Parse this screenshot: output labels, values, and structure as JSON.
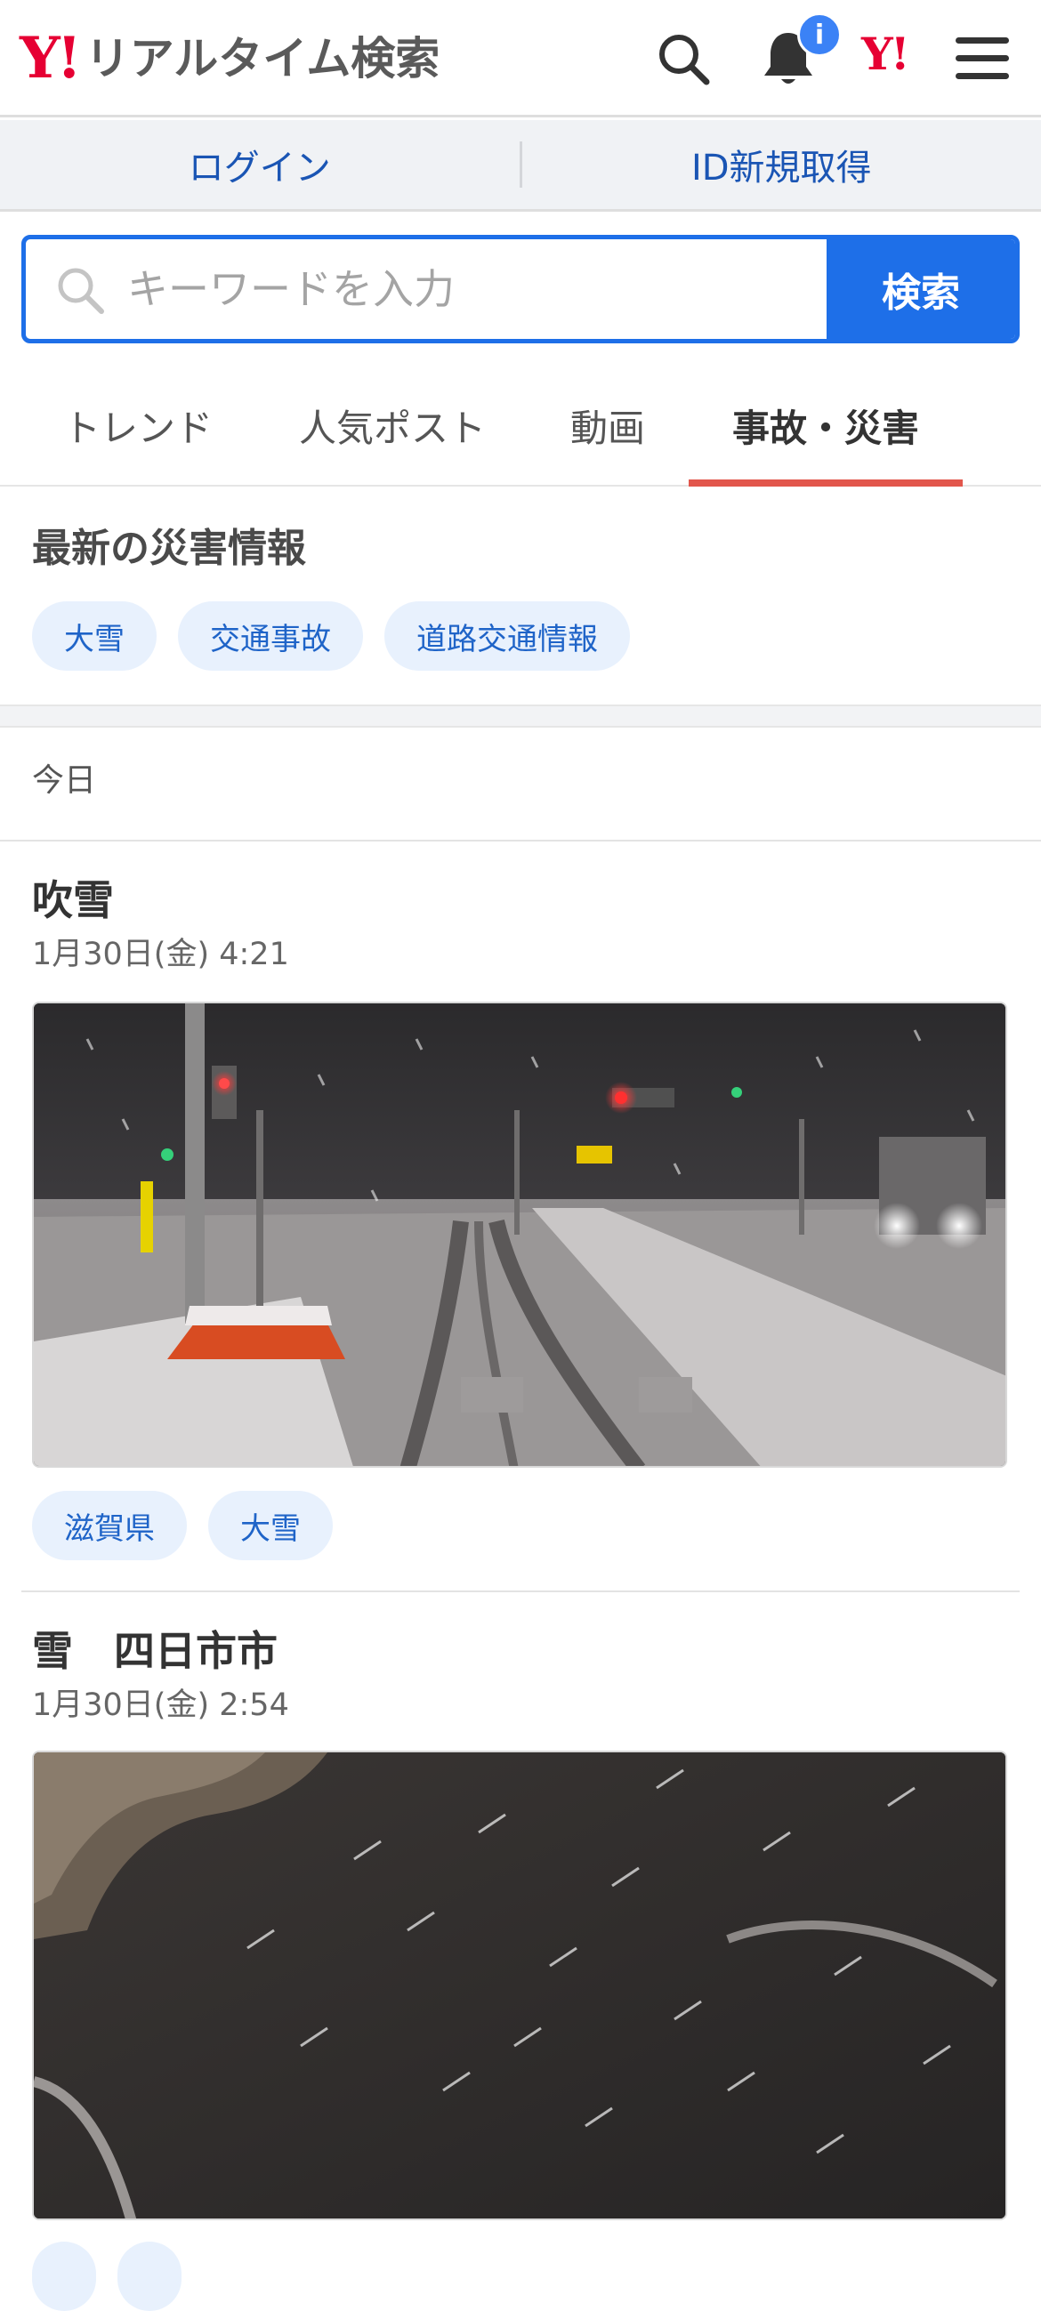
{
  "header": {
    "logo_mark": "Y!",
    "logo_text": "リアルタイム検索",
    "notification_badge": "i",
    "yahoo_mark": "Y!"
  },
  "login_bar": {
    "login_label": "ログイン",
    "register_label": "ID新規取得"
  },
  "search": {
    "placeholder": "キーワードを入力",
    "button_label": "検索"
  },
  "tabs": [
    {
      "label": "トレンド",
      "active": false
    },
    {
      "label": "人気ポスト",
      "active": false
    },
    {
      "label": "動画",
      "active": false
    },
    {
      "label": "事故・災害",
      "active": true
    }
  ],
  "disaster": {
    "title": "最新の災害情報",
    "chips": [
      "大雪",
      "交通事故",
      "道路交通情報"
    ]
  },
  "feed": {
    "date_header": "今日",
    "posts": [
      {
        "title": "吹雪",
        "time": "1月30日(金) 4:21",
        "tags": [
          "滋賀県",
          "大雪"
        ]
      },
      {
        "title": "雪　四日市市",
        "time": "1月30日(金) 2:54",
        "tags": []
      }
    ]
  },
  "colors": {
    "brand_red": "#e60033",
    "accent_blue": "#1e6fe8",
    "tab_indicator": "#e2564c",
    "chip_bg": "#e8f1fd"
  }
}
